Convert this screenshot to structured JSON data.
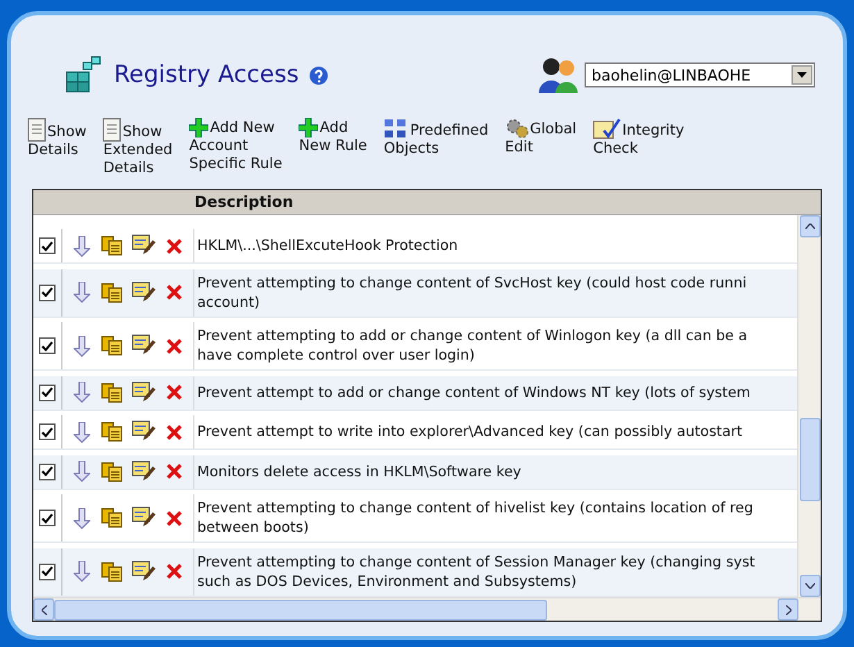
{
  "title": "Registry Access",
  "user_select": {
    "value": "baohelin@LINBAOHE"
  },
  "toolbar": [
    {
      "kind": "details",
      "lines": [
        "Show",
        "Details"
      ]
    },
    {
      "kind": "extended",
      "lines": [
        "Show",
        "Extended",
        "Details"
      ]
    },
    {
      "kind": "add",
      "lines": [
        "Add New",
        "Account",
        "Specific Rule"
      ]
    },
    {
      "kind": "add",
      "lines": [
        "Add",
        "New Rule"
      ]
    },
    {
      "kind": "objects",
      "lines": [
        "Predefined",
        "Objects"
      ]
    },
    {
      "kind": "global",
      "lines": [
        "Global",
        "Edit"
      ]
    },
    {
      "kind": "check",
      "lines": [
        "Integrity",
        "Check"
      ]
    }
  ],
  "table": {
    "columns": [
      "Description"
    ],
    "rows": [
      {
        "checked": true,
        "lines": [
          "HKLM\\...\\ShellExcuteHook Protection"
        ]
      },
      {
        "checked": true,
        "lines": [
          "Prevent attempting to change content of SvcHost key (could host code runni",
          "account)"
        ]
      },
      {
        "checked": true,
        "lines": [
          "Prevent attempting to add or change content of Winlogon key (a dll can be a",
          "have complete control over user login)"
        ]
      },
      {
        "checked": true,
        "lines": [
          "Prevent attempt to add or change content of Windows NT key (lots of system"
        ]
      },
      {
        "checked": true,
        "lines": [
          "Prevent attempt to write into explorer\\Advanced key (can possibly autostart"
        ]
      },
      {
        "checked": true,
        "lines": [
          "Monitors delete access in HKLM\\Software key"
        ]
      },
      {
        "checked": true,
        "lines": [
          "Prevent attempting to change content of hivelist key (contains location of reg",
          "between boots)"
        ]
      },
      {
        "checked": true,
        "lines": [
          "Prevent attempting to change content of Session Manager key (changing syst",
          "such as DOS Devices, Environment and Subsystems)"
        ]
      }
    ]
  }
}
